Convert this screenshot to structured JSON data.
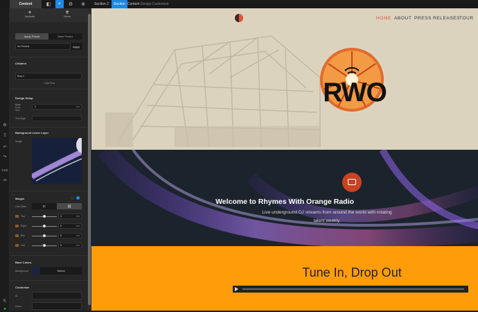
{
  "topbar": {
    "content_tab": "Content",
    "breadcrumb": [
      "Section 2",
      "Section",
      "Content",
      "Design",
      "Customize"
    ]
  },
  "panel": {
    "duplicate": "Duplicate",
    "delete": "Delete",
    "apply_preset": "Apply Preset",
    "save_preset": "Save Preset",
    "preset_value": "No Presets",
    "apply": "Apply",
    "children_title": "Children",
    "child_item": "Row 1",
    "add_row": "+ Add Row",
    "design_setup": "Design Setup",
    "base_font_size_label": "Base Font Size",
    "base_font_size_value": "1",
    "base_font_unit": "em",
    "text_align": "Text Align",
    "bg_lower_layer": "Background Lower Layer",
    "image_label": "Image",
    "margin_title": "Margin",
    "link_sides": "Link Sides",
    "margin_rows": [
      {
        "label": "Top",
        "value": "0",
        "unit": "em"
      },
      {
        "label": "Right",
        "value": "0",
        "unit": "em"
      },
      {
        "label": "Btm",
        "value": "0",
        "unit": "em"
      },
      {
        "label": "Left",
        "value": "0",
        "unit": "em"
      }
    ],
    "base_colors": "Base Colors",
    "background_label": "Background",
    "select": "Select",
    "customize": "Customize",
    "id_label": "ID",
    "class_label": "Class"
  },
  "site": {
    "nav": [
      "HOME",
      "ABOUT",
      "PRESS",
      "RELEASES",
      "TOUR"
    ],
    "logo_text": "RWO",
    "welcome_title": "Welcome to Rhymes With Orange Radio",
    "welcome_sub": "Live underground DJ streams from around the world with rotating talent weekly.",
    "tune_title": "Tune In, Drop Out"
  },
  "colors": {
    "accent_blue": "#1e88e5",
    "brand_orange": "#ff9c0a",
    "nav_active": "#e0533d",
    "hero_bg": "#dcd3bf",
    "dark_bg": "#1b232c"
  }
}
